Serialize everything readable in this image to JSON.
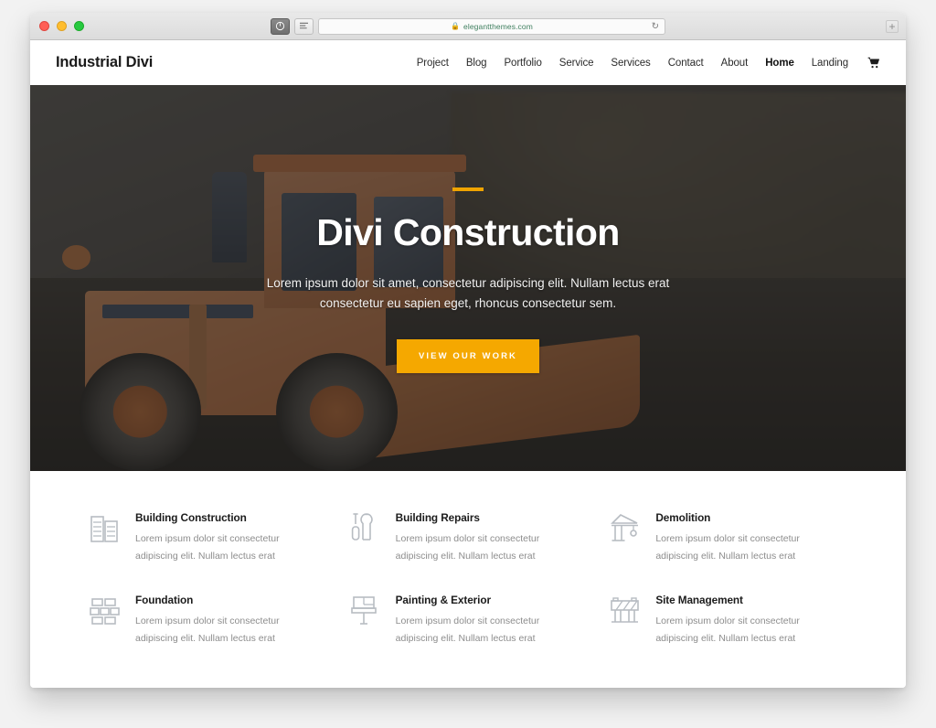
{
  "browser": {
    "traffic_lights": [
      "close",
      "minimize",
      "maximize"
    ],
    "url": "elegantthemes.com",
    "lock_icon": "padlock-icon",
    "reload_icon": "reload-icon",
    "newtab_label": "+",
    "shield_icon": "privacy-shield-icon",
    "reader_icon": "reader-view-icon"
  },
  "header": {
    "logo": "Industrial Divi",
    "nav": [
      {
        "label": "Project",
        "active": false
      },
      {
        "label": "Blog",
        "active": false
      },
      {
        "label": "Portfolio",
        "active": false
      },
      {
        "label": "Service",
        "active": false
      },
      {
        "label": "Services",
        "active": false
      },
      {
        "label": "Contact",
        "active": false
      },
      {
        "label": "About",
        "active": false
      },
      {
        "label": "Home",
        "active": true
      },
      {
        "label": "Landing",
        "active": false
      }
    ],
    "cart_icon": "shopping-cart-icon"
  },
  "hero": {
    "title": "Divi Construction",
    "subtitle": "Lorem ipsum dolor sit amet, consectetur adipiscing elit. Nullam lectus erat consectetur eu sapien eget, rhoncus consectetur sem.",
    "cta_label": "VIEW OUR WORK",
    "accent_color": "#f0a400",
    "cta_color": "#f5a800",
    "overlay_color": "rgba(28,28,28,0.62)",
    "background_image": "construction-wheel-loader-photo"
  },
  "features": [
    {
      "icon": "buildings-icon",
      "title": "Building Construction",
      "desc": "Lorem ipsum dolor sit consectetur adipiscing elit. Nullam lectus erat"
    },
    {
      "icon": "tools-wrench-screwdriver-icon",
      "title": "Building Repairs",
      "desc": "Lorem ipsum dolor sit consectetur adipiscing elit. Nullam lectus erat"
    },
    {
      "icon": "crane-icon",
      "title": "Demolition",
      "desc": "Lorem ipsum dolor sit consectetur adipiscing elit. Nullam lectus erat"
    },
    {
      "icon": "bricks-icon",
      "title": "Foundation",
      "desc": "Lorem ipsum dolor sit consectetur adipiscing elit. Nullam lectus erat"
    },
    {
      "icon": "paint-brush-icon",
      "title": "Painting & Exterior",
      "desc": "Lorem ipsum dolor sit consectetur adipiscing elit. Nullam lectus erat"
    },
    {
      "icon": "road-barrier-icon",
      "title": "Site Management",
      "desc": "Lorem ipsum dolor sit consectetur adipiscing elit. Nullam lectus erat"
    }
  ]
}
